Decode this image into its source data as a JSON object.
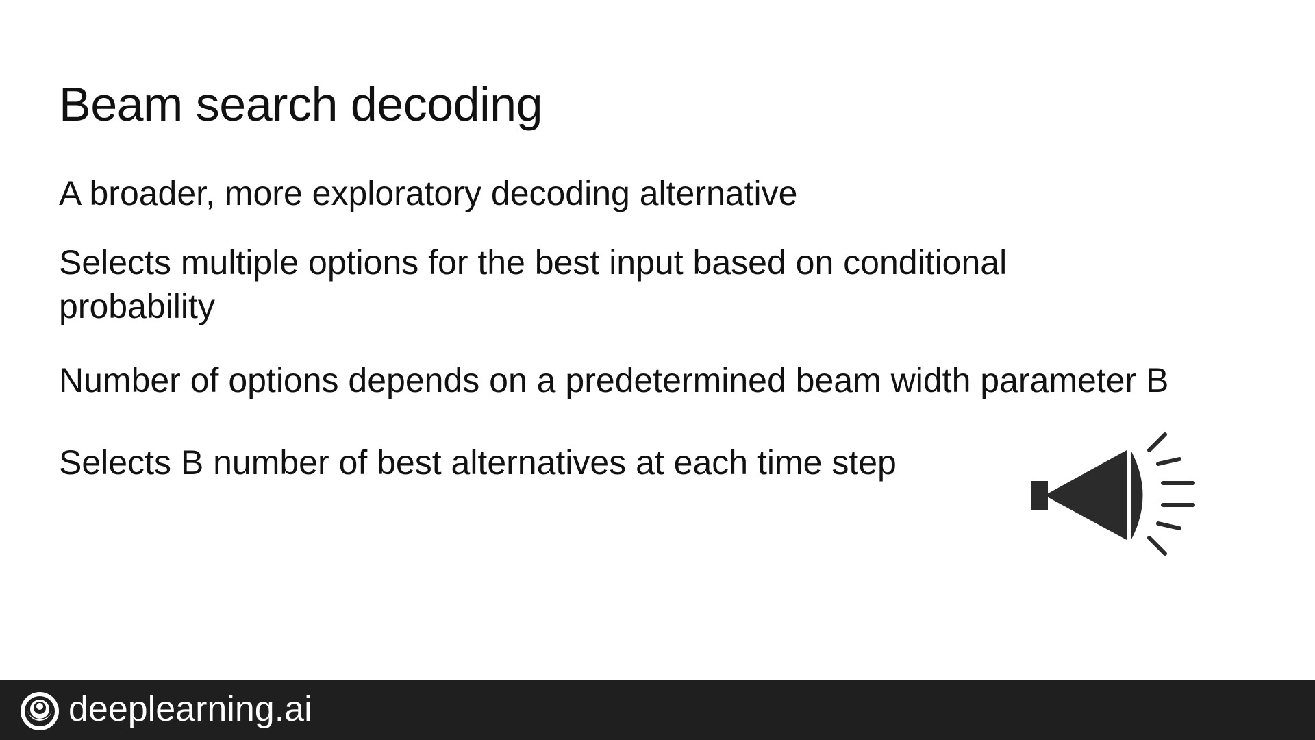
{
  "slide": {
    "title": "Beam search decoding",
    "bullets": [
      "A broader, more exploratory decoding alternative",
      "Selects multiple options for the best input based on conditional probability",
      "Number of options depends on a predetermined beam width parameter B",
      "Selects B number of best alternatives at each time step"
    ],
    "illustration_icon": "beam-light-icon"
  },
  "footer": {
    "brand": "deeplearning.ai",
    "logo_icon": "deeplearning-logo-icon",
    "background_color": "#1f1f1f"
  }
}
